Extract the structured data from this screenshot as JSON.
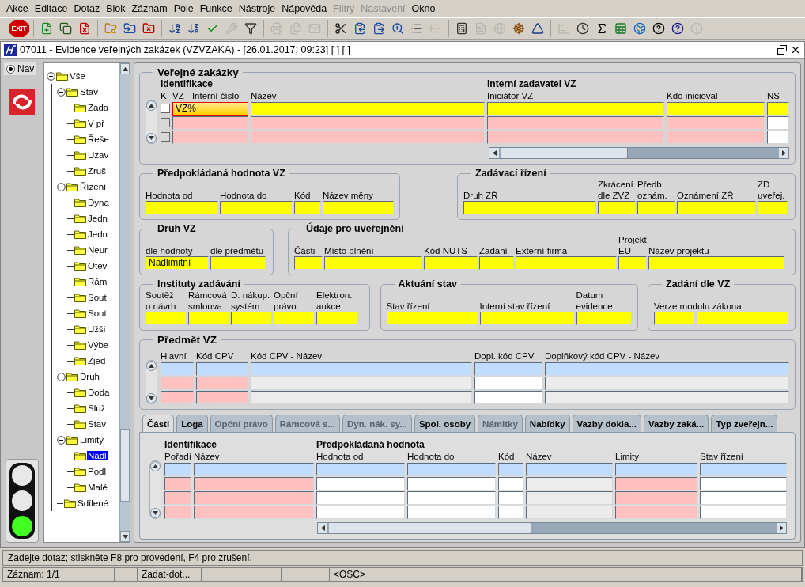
{
  "menu": [
    {
      "label": "Akce",
      "disabled": false
    },
    {
      "label": "Editace",
      "disabled": false
    },
    {
      "label": "Dotaz",
      "disabled": false
    },
    {
      "label": "Blok",
      "disabled": false
    },
    {
      "label": "Záznam",
      "disabled": false
    },
    {
      "label": "Pole",
      "disabled": false
    },
    {
      "label": "Funkce",
      "disabled": false
    },
    {
      "label": "Nástroje",
      "disabled": false
    },
    {
      "label": "Nápověda",
      "disabled": false
    },
    {
      "label": "Filtry",
      "disabled": true
    },
    {
      "label": "Nastavení",
      "disabled": true
    },
    {
      "label": "Okno",
      "disabled": false
    }
  ],
  "toolbar": {
    "exit_label": "EXIT",
    "groups": [
      [
        {
          "disabled": false
        },
        {
          "disabled": false
        },
        {
          "disabled": false
        }
      ],
      [
        {
          "disabled": false
        },
        {
          "disabled": false
        },
        {
          "disabled": false
        }
      ],
      [
        {
          "disabled": false
        },
        {
          "disabled": false
        },
        {
          "disabled": false
        },
        {
          "disabled": true
        },
        {
          "disabled": false
        }
      ],
      [
        {
          "disabled": true
        },
        {
          "disabled": true
        },
        {
          "disabled": true
        }
      ],
      [
        {
          "disabled": false
        },
        {
          "disabled": false
        },
        {
          "disabled": false
        },
        {
          "disabled": false
        },
        {
          "disabled": false
        },
        {
          "disabled": true
        }
      ],
      [
        {
          "disabled": false
        },
        {
          "disabled": true
        },
        {
          "disabled": true
        },
        {
          "disabled": false
        },
        {
          "disabled": false
        }
      ],
      [
        {
          "disabled": true
        },
        {
          "disabled": false
        },
        {
          "disabled": false
        },
        {
          "disabled": false
        },
        {
          "disabled": false
        },
        {
          "disabled": false
        },
        {
          "disabled": false
        },
        {
          "disabled": true
        }
      ]
    ]
  },
  "window": {
    "title": "07011 - Evidence veřejných zakázek (VZVZAKA) - [26.01.2017; 09:23] [ ] [ ]"
  },
  "nav": {
    "label": "Nav",
    "selected": true
  },
  "traffic_light": [
    {
      "on": false
    },
    {
      "on": false
    },
    {
      "on": true
    }
  ],
  "tree": [
    {
      "label": "Vše",
      "expanded": true,
      "selected": false,
      "children": [
        {
          "label": "Stav",
          "expanded": true,
          "selected": false,
          "children": [
            {
              "label": "Zada",
              "selected": false
            },
            {
              "label": "V př",
              "selected": false
            },
            {
              "label": "Řeše",
              "selected": false
            },
            {
              "label": "Uzav",
              "selected": false
            },
            {
              "label": "Zruš",
              "selected": false
            }
          ]
        },
        {
          "label": "Řízení",
          "expanded": true,
          "selected": false,
          "children": [
            {
              "label": "Dyna",
              "selected": false
            },
            {
              "label": "Jedn",
              "selected": false
            },
            {
              "label": "Jedn",
              "selected": false
            },
            {
              "label": "Neur",
              "selected": false
            },
            {
              "label": "Otev",
              "selected": false
            },
            {
              "label": "Rám",
              "selected": false
            },
            {
              "label": "Sout",
              "selected": false
            },
            {
              "label": "Sout",
              "selected": false
            },
            {
              "label": "Užši",
              "selected": false
            },
            {
              "label": "Výbe",
              "selected": false
            },
            {
              "label": "Zjed",
              "selected": false
            }
          ]
        },
        {
          "label": "Druh",
          "expanded": true,
          "selected": false,
          "children": [
            {
              "label": "Doda",
              "selected": false
            },
            {
              "label": "Služ",
              "selected": false
            },
            {
              "label": "Stav",
              "selected": false
            }
          ]
        },
        {
          "label": "Limity",
          "expanded": true,
          "selected": false,
          "children": [
            {
              "label": "Nadl",
              "selected": true
            },
            {
              "label": "Podl",
              "selected": false
            },
            {
              "label": "Malé",
              "selected": false
            }
          ]
        },
        {
          "label": "Sdílené",
          "selected": false
        }
      ]
    }
  ],
  "main_block": {
    "title": "Veřejné zakázky",
    "table": {
      "columns": [
        {
          "label": "K",
          "group": "Identifikace"
        },
        {
          "label": "VZ - Interní číslo"
        },
        {
          "label": "Název"
        },
        {
          "label": "Iniciátor VZ",
          "group": "Interní zadavatel VZ"
        },
        {
          "label": "Kdo inicioval"
        },
        {
          "label": "NS -"
        }
      ],
      "rows": [
        {
          "checked": false,
          "disabled": false,
          "cells": [
            {
              "kind": "query",
              "value": "VZ%",
              "focused": true
            },
            {
              "kind": "query",
              "focused": false
            },
            {
              "kind": "query",
              "focused": false
            },
            {
              "kind": "query",
              "focused": false
            },
            {
              "kind": "query",
              "focused": false
            }
          ]
        },
        {
          "checked": false,
          "disabled": true,
          "cells": [
            {
              "kind": "inactive",
              "focused": false
            },
            {
              "kind": "inactive",
              "focused": false
            },
            {
              "kind": "inactive",
              "focused": false
            },
            {
              "kind": "inactive",
              "focused": false
            },
            {
              "kind": "blank",
              "focused": false
            }
          ]
        },
        {
          "checked": false,
          "disabled": true,
          "cells": [
            {
              "kind": "inactive",
              "focused": false
            },
            {
              "kind": "inactive",
              "focused": false
            },
            {
              "kind": "inactive",
              "focused": false
            },
            {
              "kind": "inactive",
              "focused": false
            },
            {
              "kind": "blank",
              "focused": false
            }
          ]
        }
      ]
    }
  },
  "form_rows": [
    [
      {
        "title": "Předpokládaná hodnota VZ",
        "fields": [
          {
            "label": "Hodnota od",
            "kind": "query"
          },
          {
            "label": "Hodnota do",
            "kind": "query"
          },
          {
            "label": "Kód",
            "kind": "query"
          },
          {
            "label": "Název měny",
            "kind": "query"
          }
        ]
      },
      {
        "title": "Zadávací řízení",
        "fields": [
          {
            "label": "Druh ZŘ",
            "kind": "query"
          },
          {
            "label": "Zkrácení\ndle ZVZ",
            "kind": "query"
          },
          {
            "label": "Předb.\noznám.",
            "kind": "query"
          },
          {
            "label": "Oznámení ZŘ",
            "kind": "query"
          },
          {
            "label": "ZD\nuveřej.",
            "kind": "query"
          }
        ]
      }
    ],
    [
      {
        "title": "Druh VZ",
        "fields": [
          {
            "label": "dle hodnoty",
            "kind": "query",
            "value": "Nadlimitní"
          },
          {
            "label": "dle předmětu",
            "kind": "query"
          }
        ]
      },
      {
        "title": "Údaje pro uveřejnění",
        "fields": [
          {
            "label": "Části",
            "kind": "query"
          },
          {
            "label": "Místo plnění",
            "kind": "query"
          },
          {
            "label": "Kód NUTS",
            "kind": "query"
          },
          {
            "label": "Zadání",
            "kind": "query"
          },
          {
            "label": "Externí firma",
            "kind": "query"
          },
          {
            "label": "Projekt\nEU",
            "kind": "query"
          },
          {
            "label": "Název projektu",
            "kind": "query"
          }
        ]
      }
    ],
    [
      {
        "title": "Instituty zadávání",
        "fields": [
          {
            "label": "Soutěž\no návrh",
            "kind": "query"
          },
          {
            "label": "Rámcová\nsmlouva",
            "kind": "query"
          },
          {
            "label": "D. nákup.\nsystém",
            "kind": "query"
          },
          {
            "label": "Opční\nprávo",
            "kind": "query"
          },
          {
            "label": "Elektron.\naukce",
            "kind": "query"
          }
        ]
      },
      {
        "title": "Aktuání stav",
        "fields": [
          {
            "label": "Stav řízení",
            "kind": "query"
          },
          {
            "label": "Interní stav řízení",
            "kind": "query"
          },
          {
            "label": "Datum\nevidence",
            "kind": "query"
          }
        ]
      },
      {
        "title": "Zadání dle VZ",
        "fields": [
          {
            "label": "Verze modulu zákona",
            "kind": "query"
          },
          {
            "kind": "query"
          }
        ]
      }
    ]
  ],
  "subject_block": {
    "title": "Předmět VZ",
    "table": {
      "columns": [
        {
          "label": "Hlavní"
        },
        {
          "label": "Kód CPV"
        },
        {
          "label": "Kód CPV - Název"
        },
        {
          "label": "Dopl. kód CPV"
        },
        {
          "label": "Doplňkový kód CPV - Název"
        }
      ],
      "rows": [
        {
          "cells": [
            {
              "kind": "current"
            },
            {
              "kind": "current"
            },
            {
              "kind": "current"
            },
            {
              "kind": "current"
            },
            {
              "kind": "current"
            }
          ]
        },
        {
          "cells": [
            {
              "kind": "inactive"
            },
            {
              "kind": "inactive"
            },
            {
              "kind": "readonly"
            },
            {
              "kind": "blank"
            },
            {
              "kind": "readonly"
            }
          ]
        },
        {
          "cells": [
            {
              "kind": "inactive"
            },
            {
              "kind": "inactive"
            },
            {
              "kind": "readonly"
            },
            {
              "kind": "blank"
            },
            {
              "kind": "readonly"
            }
          ]
        }
      ]
    }
  },
  "tabs": [
    {
      "label": "Části",
      "selected": true,
      "disabled": false
    },
    {
      "label": "Loga",
      "selected": false,
      "disabled": false
    },
    {
      "label": "Opční právo",
      "selected": false,
      "disabled": true
    },
    {
      "label": "Rámcová s...",
      "selected": false,
      "disabled": true
    },
    {
      "label": "Dyn. nák. sy...",
      "selected": false,
      "disabled": true
    },
    {
      "label": "Spol. osoby",
      "selected": false,
      "disabled": false
    },
    {
      "label": "Námitky",
      "selected": false,
      "disabled": true
    },
    {
      "label": "Nabídky",
      "selected": false,
      "disabled": false
    },
    {
      "label": "Vazby dokla...",
      "selected": false,
      "disabled": false
    },
    {
      "label": "Vazby zaká...",
      "selected": false,
      "disabled": false
    },
    {
      "label": "Typ zveřejn...",
      "selected": false,
      "disabled": false
    }
  ],
  "tab_table": {
    "columns": [
      {
        "label": "Pořadí",
        "group": "Identifikace"
      },
      {
        "label": "Název"
      },
      {
        "label": "Hodnota od",
        "group": "Předpokládaná hodnota"
      },
      {
        "label": "Hodnota do"
      },
      {
        "label": "Kód"
      },
      {
        "label": "Název"
      },
      {
        "label": "Limity"
      },
      {
        "label": "Stav řízení"
      }
    ],
    "rows": [
      {
        "cells": [
          {
            "kind": "current"
          },
          {
            "kind": "current"
          },
          {
            "kind": "current"
          },
          {
            "kind": "current"
          },
          {
            "kind": "current"
          },
          {
            "kind": "current"
          },
          {
            "kind": "current"
          },
          {
            "kind": "current"
          }
        ]
      },
      {
        "cells": [
          {
            "kind": "inactive"
          },
          {
            "kind": "inactive"
          },
          {
            "kind": "blank"
          },
          {
            "kind": "blank"
          },
          {
            "kind": "blank"
          },
          {
            "kind": "readonly"
          },
          {
            "kind": "inactive"
          },
          {
            "kind": "blank"
          }
        ]
      },
      {
        "cells": [
          {
            "kind": "inactive"
          },
          {
            "kind": "inactive"
          },
          {
            "kind": "blank"
          },
          {
            "kind": "blank"
          },
          {
            "kind": "blank"
          },
          {
            "kind": "readonly"
          },
          {
            "kind": "inactive"
          },
          {
            "kind": "blank"
          }
        ]
      },
      {
        "cells": [
          {
            "kind": "inactive"
          },
          {
            "kind": "inactive"
          },
          {
            "kind": "blank"
          },
          {
            "kind": "blank"
          },
          {
            "kind": "blank"
          },
          {
            "kind": "readonly"
          },
          {
            "kind": "inactive"
          },
          {
            "kind": "blank"
          }
        ]
      }
    ]
  },
  "status_bar": {
    "message": "Zadejte dotaz; stiskněte F8 pro provedení, F4 pro zrušení.",
    "record": "Záznam: 1/1",
    "mode": "Zadat-dot...",
    "osc": "<OSC>"
  }
}
